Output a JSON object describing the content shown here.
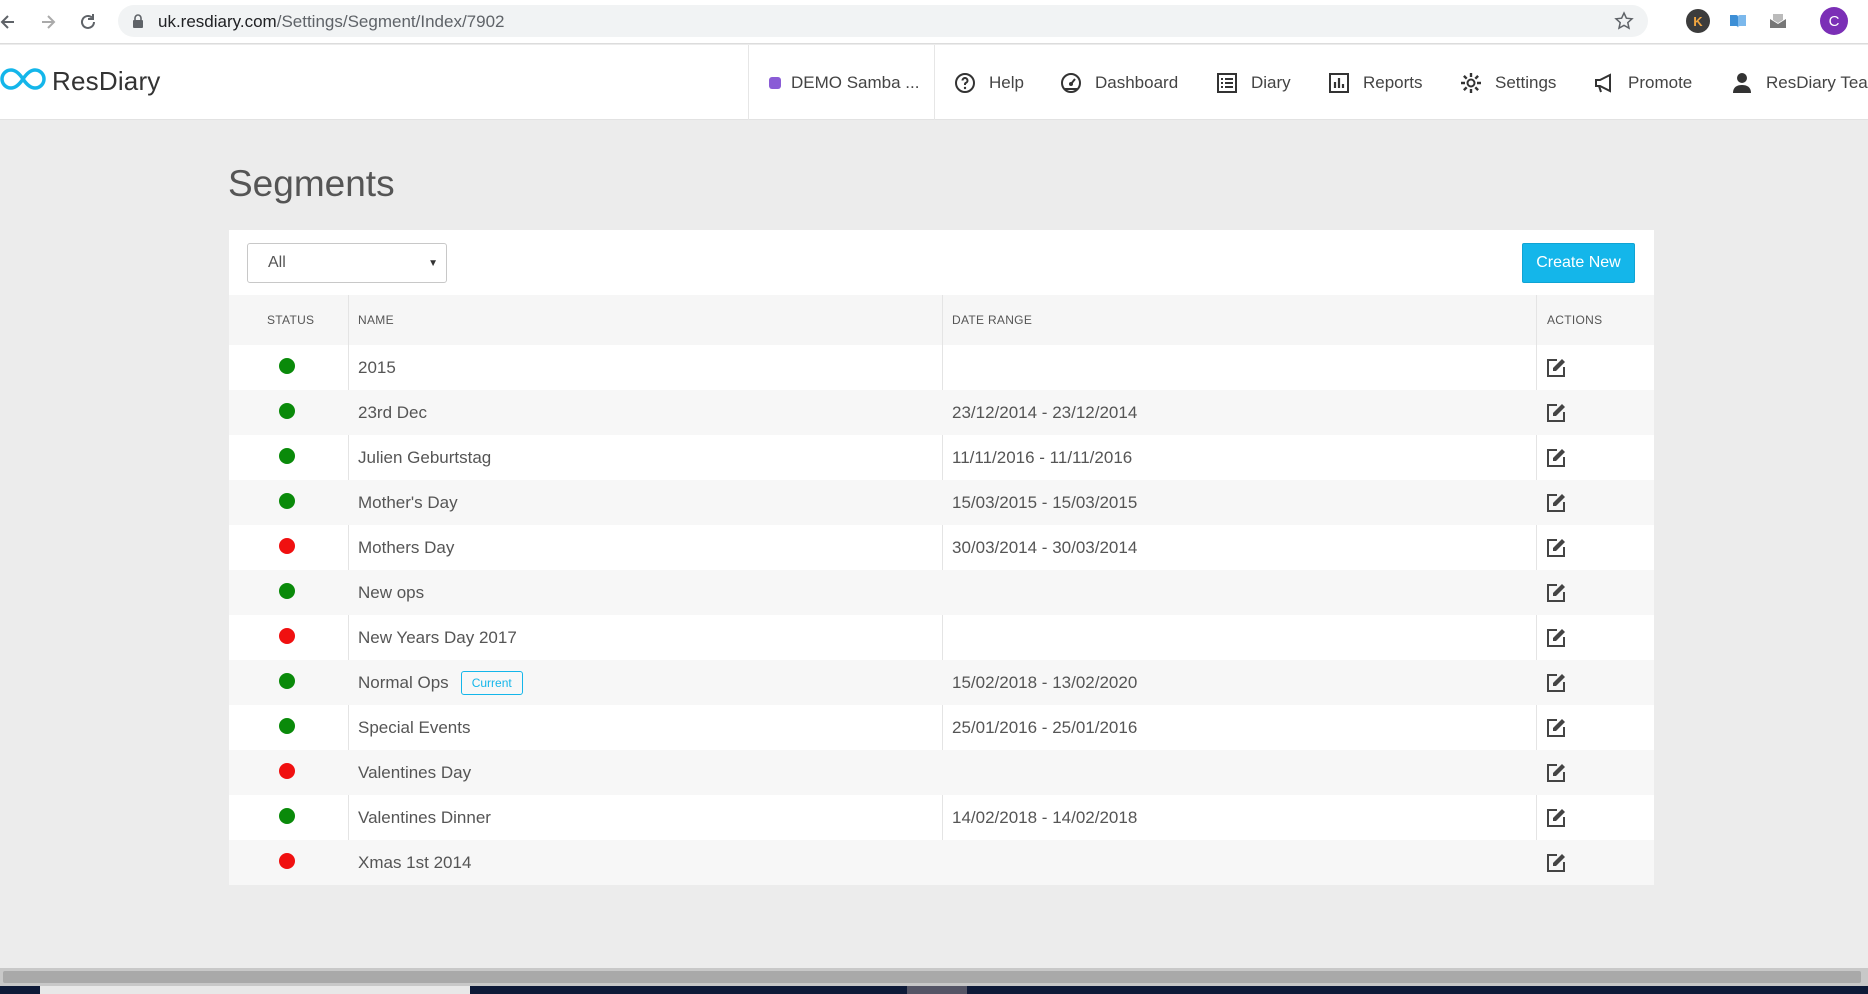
{
  "browser": {
    "url_host": "uk.resdiary.com",
    "url_path": "/Settings/Segment/Index/7902",
    "profile_initial": "C",
    "ext_k_label": "K"
  },
  "header": {
    "logo_text": "ResDiary",
    "venue": "DEMO Samba ...",
    "nav": {
      "help": "Help",
      "dashboard": "Dashboard",
      "diary": "Diary",
      "reports": "Reports",
      "settings": "Settings",
      "promote": "Promote",
      "user": "ResDiary Tea..."
    }
  },
  "page": {
    "title": "Segments",
    "filter_value": "All",
    "create_label": "Create New"
  },
  "table": {
    "headers": {
      "status": "STATUS",
      "name": "NAME",
      "date_range": "DATE RANGE",
      "actions": "ACTIONS"
    },
    "rows": [
      {
        "status": "active",
        "name": "2015",
        "date_range": "",
        "badge": ""
      },
      {
        "status": "active",
        "name": "23rd Dec",
        "date_range": "23/12/2014 - 23/12/2014",
        "badge": ""
      },
      {
        "status": "active",
        "name": "Julien Geburtstag",
        "date_range": "11/11/2016 - 11/11/2016",
        "badge": ""
      },
      {
        "status": "active",
        "name": "Mother's Day",
        "date_range": "15/03/2015 - 15/03/2015",
        "badge": ""
      },
      {
        "status": "inactive",
        "name": "Mothers Day",
        "date_range": "30/03/2014 - 30/03/2014",
        "badge": ""
      },
      {
        "status": "active",
        "name": "New ops",
        "date_range": "",
        "badge": ""
      },
      {
        "status": "inactive",
        "name": "New Years Day 2017",
        "date_range": "",
        "badge": ""
      },
      {
        "status": "active",
        "name": "Normal Ops",
        "date_range": "15/02/2018 - 13/02/2020",
        "badge": "Current"
      },
      {
        "status": "active",
        "name": "Special Events",
        "date_range": "25/01/2016 - 25/01/2016",
        "badge": ""
      },
      {
        "status": "inactive",
        "name": "Valentines Day",
        "date_range": "",
        "badge": ""
      },
      {
        "status": "active",
        "name": "Valentines Dinner",
        "date_range": "14/02/2018 - 14/02/2018",
        "badge": ""
      },
      {
        "status": "inactive",
        "name": "Xmas 1st 2014",
        "date_range": "",
        "badge": ""
      }
    ]
  },
  "colors": {
    "active": "#0a8a0a",
    "inactive": "#f01010",
    "accent": "#14b6ea",
    "venue_dot": "#8a5cd6"
  },
  "icons": {
    "edit": "edit-icon",
    "help": "question-circle-icon",
    "dashboard": "gauge-icon",
    "diary": "list-icon",
    "reports": "bar-chart-icon",
    "settings": "gear-icon",
    "promote": "megaphone-icon",
    "user": "user-icon"
  }
}
